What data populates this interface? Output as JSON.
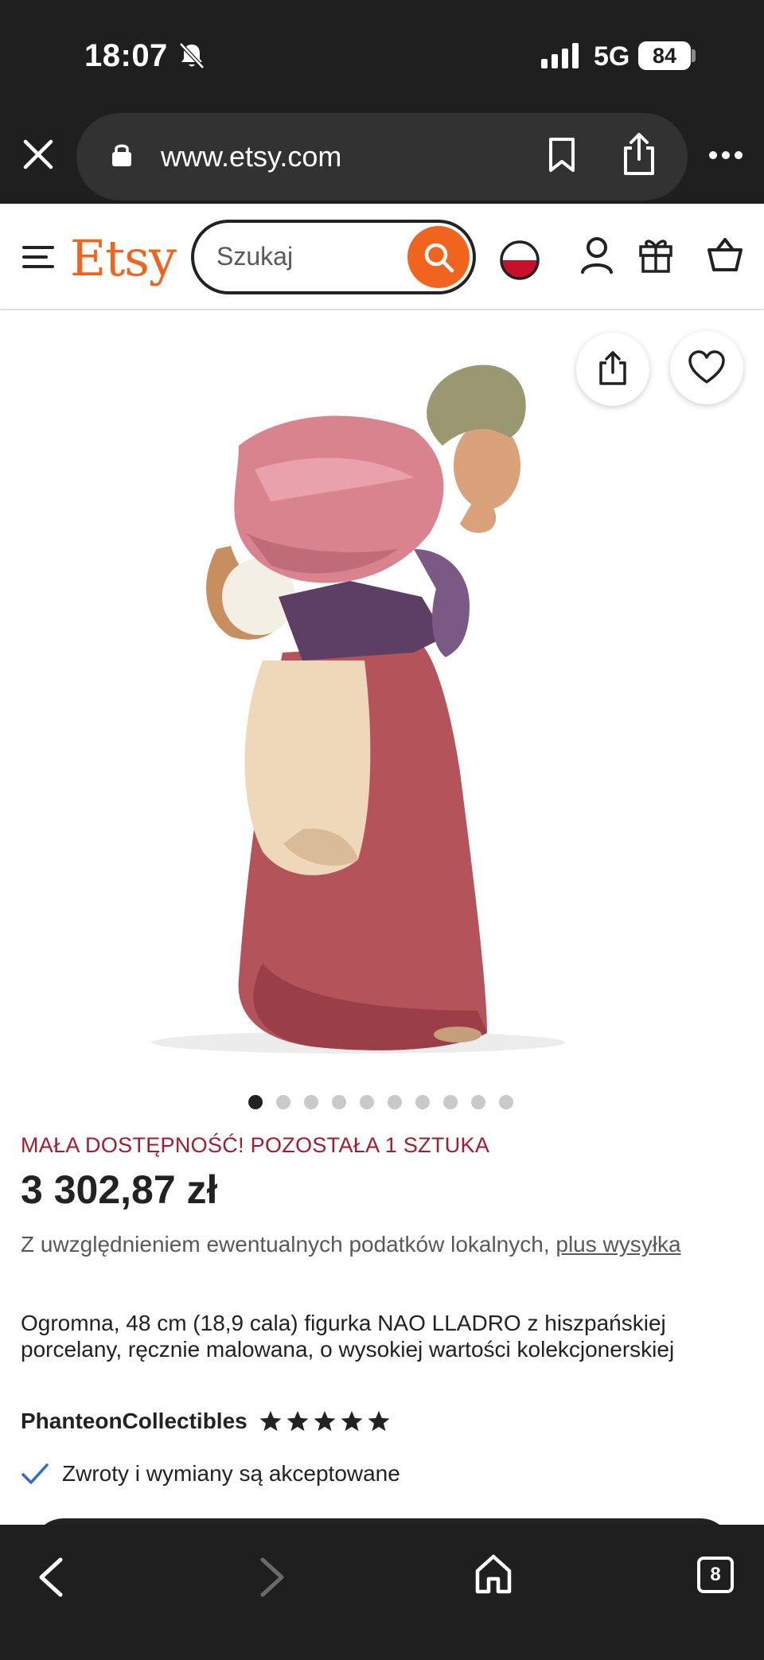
{
  "status_bar": {
    "time": "18:07",
    "network": "5G",
    "battery": "84",
    "icons": [
      "bell-off-icon",
      "signal-icon"
    ]
  },
  "browser": {
    "url": "www.etsy.com",
    "icons": [
      "close-icon",
      "lock-icon",
      "bookmark-icon",
      "share-icon",
      "more-icon"
    ]
  },
  "header": {
    "logo": "Etsy",
    "search_placeholder": "Szukaj",
    "icons": [
      "menu-icon",
      "search-icon",
      "flag-icon",
      "account-icon",
      "gift-icon",
      "cart-icon"
    ]
  },
  "gallery": {
    "image_count": 10,
    "active_index": 0
  },
  "listing": {
    "stock_note": "MAŁA DOSTĘPNOŚĆ! POZOSTAŁA 1 SZTUKA",
    "price": "3 302,87 zł",
    "tax_note": "Z uwzględnieniem ewentualnych podatków lokalnych,",
    "shipping_link": "plus wysyłka",
    "title": "Ogromna, 48 cm (18,9 cala) figurka NAO LLADRO z hiszpańskiej porcelany, ręcznie malowana, o wysokiej wartości kolekcjonerskiej",
    "shop_name": "PhanteonCollectibles",
    "rating": 5,
    "returns": "Zwroty i wymiany są akceptowane"
  },
  "bottom_nav": {
    "tab_count": "8",
    "icons": [
      "back-icon",
      "forward-icon",
      "home-icon",
      "tabs-icon"
    ]
  },
  "colors": {
    "etsy_orange": "#f1641e",
    "stock_red": "#a61a2e",
    "chrome_dark": "#1f1f1f"
  }
}
